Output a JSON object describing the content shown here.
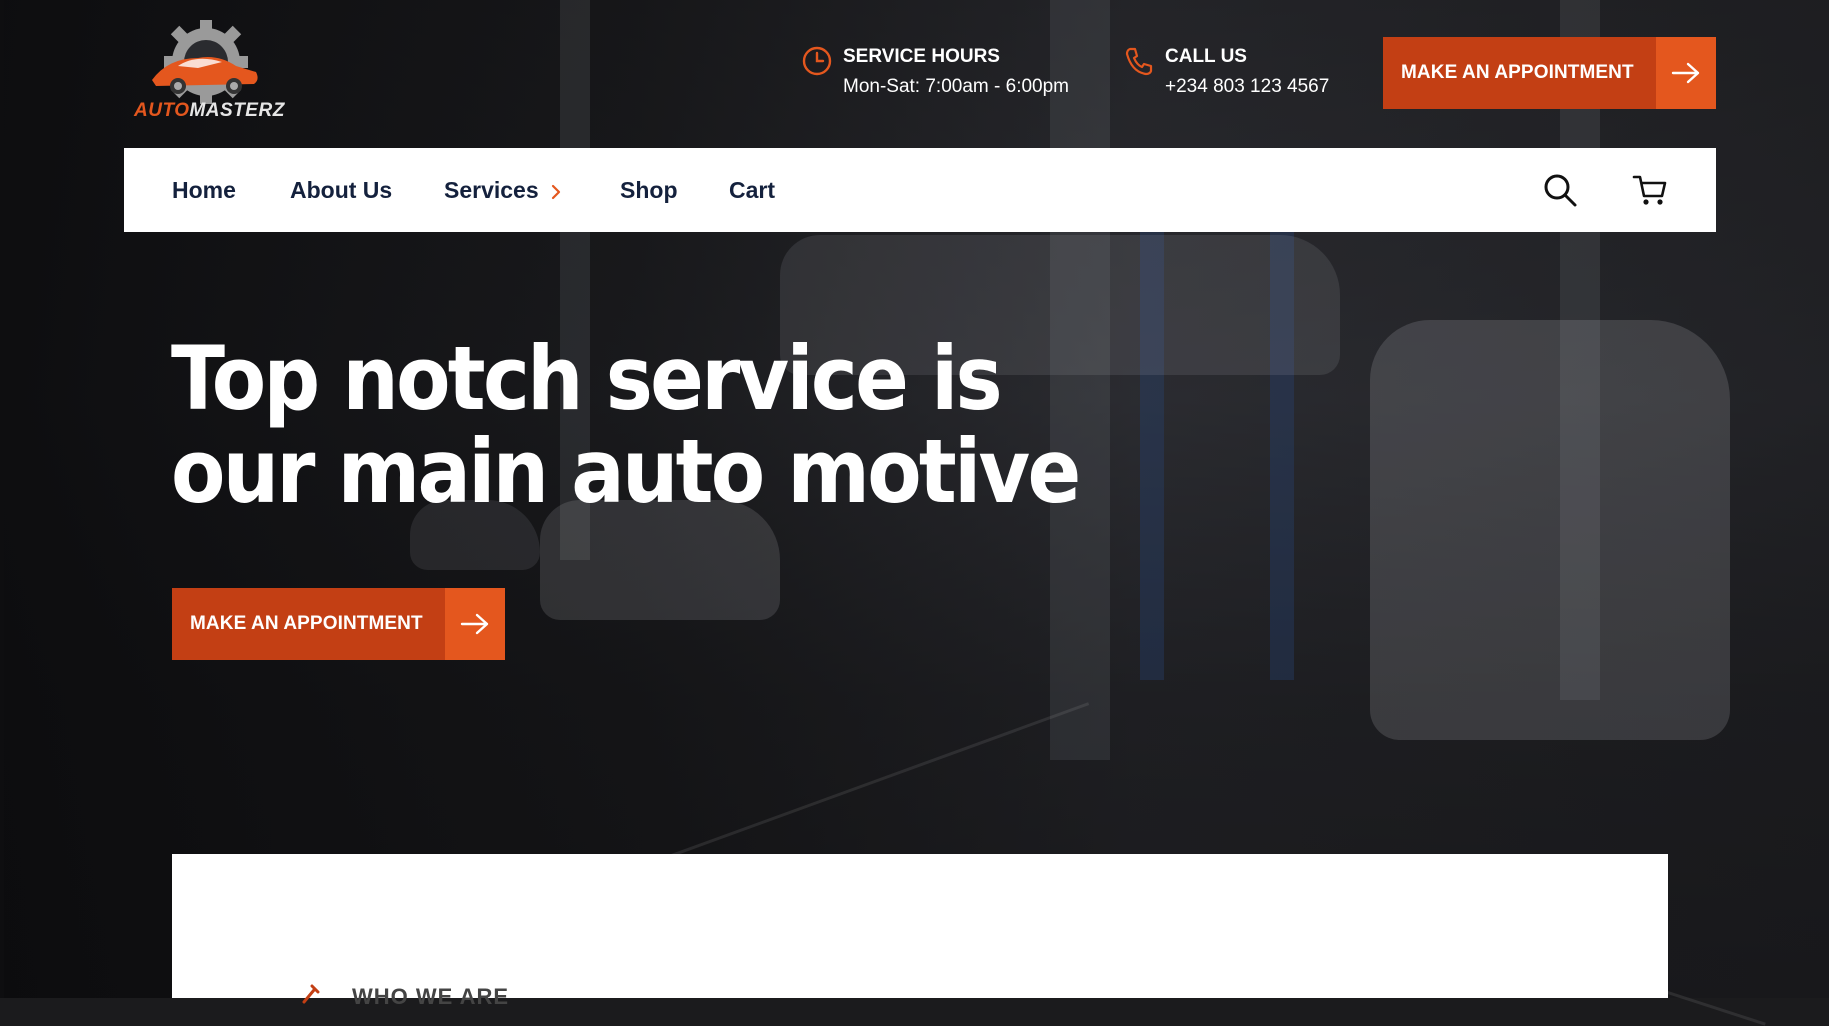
{
  "brand": {
    "name_part1": "AUTO",
    "name_part2": "MASTERZ",
    "accent": "#e4571e"
  },
  "top_info": {
    "hours": {
      "icon": "clock-icon",
      "title": "SERVICE HOURS",
      "value": "Mon-Sat: 7:00am - 6:00pm"
    },
    "call": {
      "icon": "phone-icon",
      "title": "CALL US",
      "value": "+234 803 123 4567"
    }
  },
  "header_cta": {
    "label": "MAKE AN APPOINTMENT",
    "icon": "arrow-right-icon"
  },
  "nav": {
    "items": [
      {
        "label": "Home"
      },
      {
        "label": "About Us"
      },
      {
        "label": "Services",
        "icon": "chevron-right-icon"
      },
      {
        "label": "Shop"
      },
      {
        "label": "Cart"
      }
    ],
    "search_icon": "search-icon",
    "cart_icon": "cart-icon"
  },
  "hero": {
    "title_line1": "Top notch service is",
    "title_line2": "our main auto motive",
    "cta_label": "MAKE AN APPOINTMENT",
    "cta_icon": "arrow-right-icon"
  },
  "about_card": {
    "eyebrow": "WHO WE ARE"
  },
  "colors": {
    "primary": "#c33f14",
    "primary_light": "#e4571e",
    "nav_text": "#14213d"
  }
}
